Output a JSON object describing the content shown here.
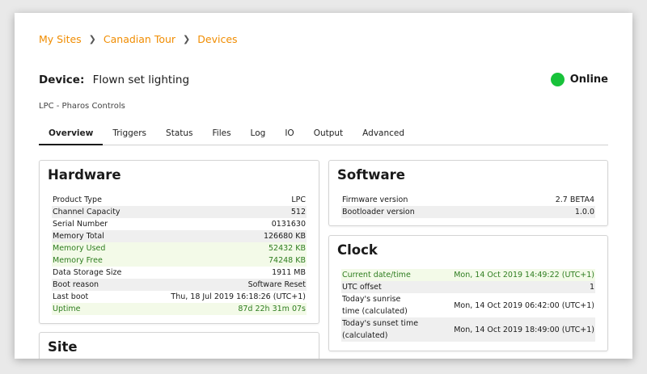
{
  "breadcrumb": [
    "My Sites",
    "Canadian Tour",
    "Devices"
  ],
  "device": {
    "label": "Device:",
    "name": "Flown set lighting",
    "subtitle": "LPC - Pharos Controls",
    "status": "Online",
    "status_color": "#18c23a"
  },
  "tabs": [
    "Overview",
    "Triggers",
    "Status",
    "Files",
    "Log",
    "IO",
    "Output",
    "Advanced"
  ],
  "hardware": {
    "title": "Hardware",
    "rows": [
      {
        "k": "Product Type",
        "v": "LPC"
      },
      {
        "k": "Channel Capacity",
        "v": "512"
      },
      {
        "k": "Serial Number",
        "v": "0131630"
      },
      {
        "k": "Memory Total",
        "v": "126680 KB"
      },
      {
        "k": "Memory Used",
        "v": "52432 KB"
      },
      {
        "k": "Memory Free",
        "v": "74248 KB"
      },
      {
        "k": "Data Storage Size",
        "v": "1911 MB"
      },
      {
        "k": "Boot reason",
        "v": "Software Reset"
      },
      {
        "k": "Last boot",
        "v": "Thu, 18 Jul 2019 16:18:26 (UTC+1)"
      },
      {
        "k": "Uptime",
        "v": "87d 22h 31m 07s"
      }
    ]
  },
  "site": {
    "title": "Site"
  },
  "software": {
    "title": "Software",
    "rows": [
      {
        "k": "Firmware version",
        "v": "2.7 BETA4"
      },
      {
        "k": "Bootloader version",
        "v": "1.0.0"
      }
    ]
  },
  "clock": {
    "title": "Clock",
    "rows": [
      {
        "k": "Current date/time",
        "v": "Mon, 14 Oct 2019 14:49:22 (UTC+1)"
      },
      {
        "k": "UTC offset",
        "v": "1"
      },
      {
        "k": "Today's sunrise\ntime (calculated)",
        "v": "Mon, 14 Oct 2019 06:42:00 (UTC+1)"
      },
      {
        "k": "Today's sunset time\n(calculated)",
        "v": "Mon, 14 Oct 2019 18:49:00 (UTC+1)"
      }
    ]
  }
}
